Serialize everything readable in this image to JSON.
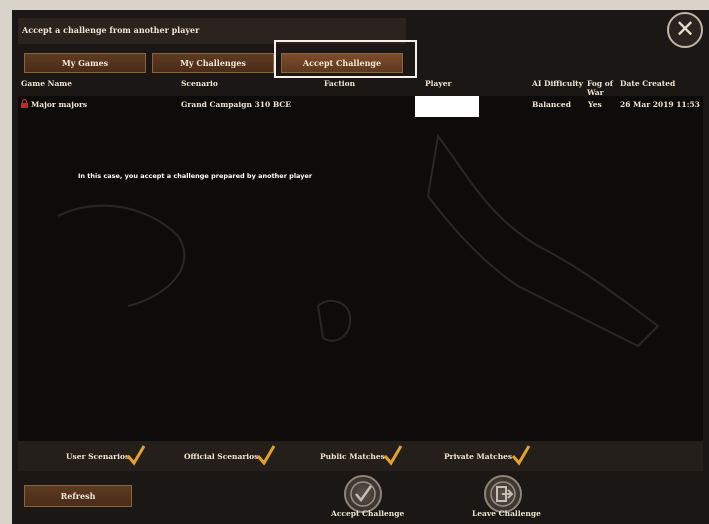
{
  "header": {
    "title": "Accept a challenge from another player"
  },
  "tabs": [
    {
      "label": "My Games"
    },
    {
      "label": "My Challenges"
    },
    {
      "label": "Accept Challenge"
    }
  ],
  "columns": {
    "game_name": "Game Name",
    "scenario": "Scenario",
    "faction": "Faction",
    "player": "Player",
    "ai_difficulty": "AI Difficulty",
    "fog_of_war": "Fog of War",
    "date_created": "Date Created"
  },
  "rows": [
    {
      "game_name": "Major majors",
      "scenario": "Grand Campaign 310 BCE",
      "faction": "",
      "player": "",
      "ai_difficulty": "Balanced",
      "fog_of_war": "Yes",
      "date_created": "26 Mar 2019 11:53"
    }
  ],
  "annotation": "In this case, you accept a challenge prepared by another player",
  "filters": [
    {
      "label": "User Scenarios",
      "checked": true
    },
    {
      "label": "Official Scenarios",
      "checked": true
    },
    {
      "label": "Public Matches",
      "checked": true
    },
    {
      "label": "Private Matches",
      "checked": true
    }
  ],
  "footer": {
    "refresh_label": "Refresh",
    "accept_label": "Accept Challenge",
    "leave_label": "Leave Challenge"
  },
  "icons": {
    "close": "close-icon",
    "lock": "lock-icon",
    "check": "checkmark-icon",
    "accept": "accept-check-icon",
    "leave": "leave-icon"
  }
}
